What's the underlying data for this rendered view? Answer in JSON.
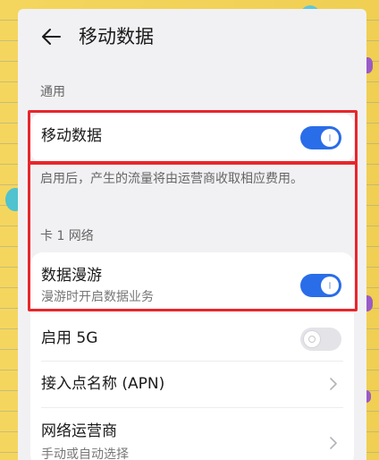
{
  "header": {
    "title": "移动数据"
  },
  "sections": {
    "general": "通用",
    "sim1": "卡 1 网络"
  },
  "mobile_data": {
    "label": "移动数据",
    "enabled": true
  },
  "mobile_data_desc": "启用后，产生的流量将由运营商收取相应费用。",
  "roaming": {
    "label": "数据漫游",
    "sublabel": "漫游时开启数据业务",
    "enabled": true
  },
  "enable_5g": {
    "label": "启用 5G",
    "enabled": false
  },
  "apn": {
    "label": "接入点名称 (APN)"
  },
  "carrier": {
    "label": "网络运营商",
    "sublabel": "手动或自动选择"
  },
  "colors": {
    "accent": "#2a6de8",
    "highlight": "#e8262b",
    "background": "#f1f1f4"
  },
  "icons": {
    "back": "back-arrow-icon",
    "chevron": "chevron-right-icon"
  }
}
